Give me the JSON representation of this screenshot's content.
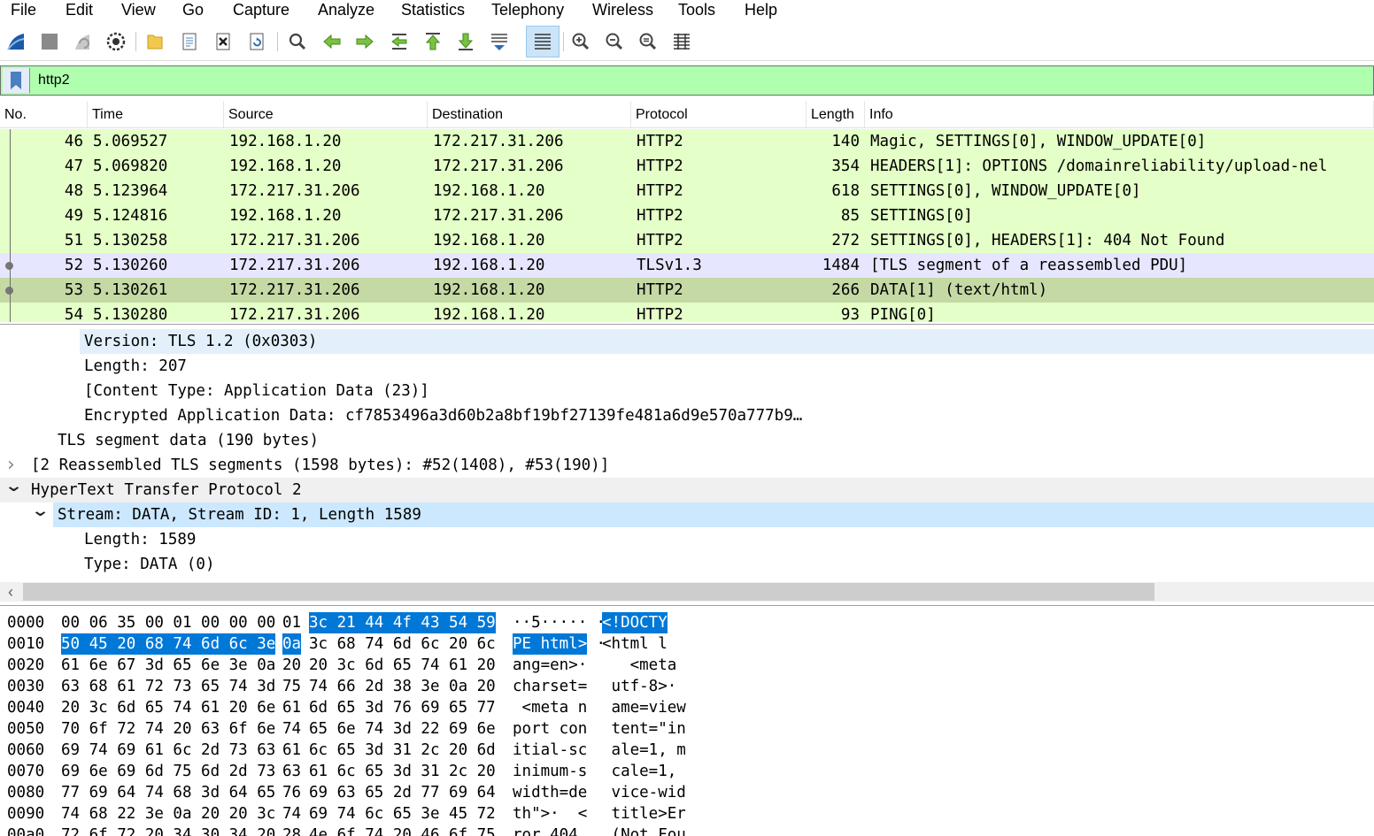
{
  "menu": [
    "File",
    "Edit",
    "View",
    "Go",
    "Capture",
    "Analyze",
    "Statistics",
    "Telephony",
    "Wireless",
    "Tools",
    "Help"
  ],
  "toolbar_icons": [
    "start-capture-icon",
    "stop-capture-icon",
    "restart-capture-icon",
    "capture-options-icon",
    "open-file-icon",
    "save-file-icon",
    "close-file-icon",
    "reload-file-icon",
    "find-packet-icon",
    "go-back-icon",
    "go-forward-icon",
    "go-to-packet-icon",
    "go-first-packet-icon",
    "go-last-packet-icon",
    "autoscroll-icon",
    "colorize-icon",
    "zoom-in-icon",
    "zoom-out-icon",
    "normal-size-icon",
    "resize-columns-icon"
  ],
  "filter": {
    "value": "http2",
    "background": "#afffaf"
  },
  "columns": [
    "No.",
    "Time",
    "Source",
    "Destination",
    "Protocol",
    "Length",
    "Info"
  ],
  "packets": [
    {
      "no": "46",
      "time": "5.069527",
      "src": "192.168.1.20",
      "dst": "172.217.31.206",
      "proto": "HTTP2",
      "len": "140",
      "info": "Magic, SETTINGS[0], WINDOW_UPDATE[0]",
      "bg": "#e4ffc7"
    },
    {
      "no": "47",
      "time": "5.069820",
      "src": "192.168.1.20",
      "dst": "172.217.31.206",
      "proto": "HTTP2",
      "len": "354",
      "info": "HEADERS[1]: OPTIONS /domainreliability/upload-nel",
      "bg": "#e4ffc7"
    },
    {
      "no": "48",
      "time": "5.123964",
      "src": "172.217.31.206",
      "dst": "192.168.1.20",
      "proto": "HTTP2",
      "len": "618",
      "info": "SETTINGS[0], WINDOW_UPDATE[0]",
      "bg": "#e4ffc7"
    },
    {
      "no": "49",
      "time": "5.124816",
      "src": "192.168.1.20",
      "dst": "172.217.31.206",
      "proto": "HTTP2",
      "len": "85",
      "info": "SETTINGS[0]",
      "bg": "#e4ffc7"
    },
    {
      "no": "51",
      "time": "5.130258",
      "src": "172.217.31.206",
      "dst": "192.168.1.20",
      "proto": "HTTP2",
      "len": "272",
      "info": "SETTINGS[0], HEADERS[1]: 404 Not Found",
      "bg": "#e4ffc7"
    },
    {
      "no": "52",
      "time": "5.130260",
      "src": "172.217.31.206",
      "dst": "192.168.1.20",
      "proto": "TLSv1.3",
      "len": "1484",
      "info": "[TLS segment of a reassembled PDU]",
      "bg": "#e7e6ff"
    },
    {
      "no": "53",
      "time": "5.130261",
      "src": "172.217.31.206",
      "dst": "192.168.1.20",
      "proto": "HTTP2",
      "len": "266",
      "info": "DATA[1] (text/html)",
      "bg": "#c5d9a5"
    },
    {
      "no": "54",
      "time": "5.130280",
      "src": "172.217.31.206",
      "dst": "192.168.1.20",
      "proto": "HTTP2",
      "len": "93",
      "info": "PING[0]",
      "bg": "#e4ffc7"
    }
  ],
  "details": [
    {
      "text": "Version: TLS 1.2 (0x0303)",
      "indent": 95,
      "bg": "#e3f0fb",
      "arrow": ""
    },
    {
      "text": "Length: 207",
      "indent": 95,
      "bg": "#ffffff",
      "arrow": ""
    },
    {
      "text": "[Content Type: Application Data (23)]",
      "indent": 95,
      "bg": "#ffffff",
      "arrow": ""
    },
    {
      "text": "Encrypted Application Data: cf7853496a3d60b2a8bf19bf27139fe481a6d9e570a777b9…",
      "indent": 95,
      "bg": "#ffffff",
      "arrow": ""
    },
    {
      "text": "TLS segment data (190 bytes)",
      "indent": 65,
      "bg": "#ffffff",
      "arrow": ""
    },
    {
      "text": "[2 Reassembled TLS segments (1598 bytes): #52(1408), #53(190)]",
      "indent": 35,
      "bg": "#ffffff",
      "arrow": "›"
    },
    {
      "text": "HyperText Transfer Protocol 2",
      "indent": 35,
      "bg": "#f0f0f0",
      "arrow": "⌄"
    },
    {
      "text": "Stream: DATA, Stream ID: 1, Length 1589",
      "indent": 65,
      "bg": "#cce8ff",
      "arrow": "⌄"
    },
    {
      "text": "Length: 1589",
      "indent": 95,
      "bg": "#ffffff",
      "arrow": ""
    },
    {
      "text": "Type: DATA (0)",
      "indent": 95,
      "bg": "#ffffff",
      "arrow": ""
    }
  ],
  "bytes": [
    {
      "off": "0000",
      "h1": "00 06 35 00 01 00 00 00",
      "h2a": "01",
      "h2b": "3c 21 44 4f 43 54 59",
      "a1": "··5·····",
      "a2a": " ·",
      "a2b": "<!DOCTY",
      "hl": "second"
    },
    {
      "off": "0010",
      "h1": "50 45 20 68 74 6d 6c 3e",
      "h2a": "0a",
      "h2b": "3c 68 74 6d 6c 20 6c",
      "a1": "PE html>",
      "a2a": " ·",
      "a2b": "<html l",
      "hl": "first"
    },
    {
      "off": "0020",
      "h1": "61 6e 67 3d 65 6e 3e 0a",
      "h2a": "20",
      "h2b": "20 3c 6d 65 74 61 20",
      "a1": "ang=en>·",
      "a2a": "",
      "a2b": "   <meta",
      "hl": ""
    },
    {
      "off": "0030",
      "h1": "63 68 61 72 73 65 74 3d",
      "h2a": "75",
      "h2b": "74 66 2d 38 3e 0a 20",
      "a1": "charset=",
      "a2a": "",
      "a2b": " utf-8>·",
      "hl": ""
    },
    {
      "off": "0040",
      "h1": "20 3c 6d 65 74 61 20 6e",
      "h2a": "61",
      "h2b": "6d 65 3d 76 69 65 77",
      "a1": " <meta n",
      "a2a": "",
      "a2b": " ame=view",
      "hl": ""
    },
    {
      "off": "0050",
      "h1": "70 6f 72 74 20 63 6f 6e",
      "h2a": "74",
      "h2b": "65 6e 74 3d 22 69 6e",
      "a1": "port con",
      "a2a": "",
      "a2b": " tent=\"in",
      "hl": ""
    },
    {
      "off": "0060",
      "h1": "69 74 69 61 6c 2d 73 63",
      "h2a": "61",
      "h2b": "6c 65 3d 31 2c 20 6d",
      "a1": "itial-sc",
      "a2a": "",
      "a2b": " ale=1, m",
      "hl": ""
    },
    {
      "off": "0070",
      "h1": "69 6e 69 6d 75 6d 2d 73",
      "h2a": "63",
      "h2b": "61 6c 65 3d 31 2c 20",
      "a1": "inimum-s",
      "a2a": "",
      "a2b": " cale=1,",
      "hl": ""
    },
    {
      "off": "0080",
      "h1": "77 69 64 74 68 3d 64 65",
      "h2a": "76",
      "h2b": "69 63 65 2d 77 69 64",
      "a1": "width=de",
      "a2a": "",
      "a2b": " vice-wid",
      "hl": ""
    },
    {
      "off": "0090",
      "h1": "74 68 22 3e 0a 20 20 3c",
      "h2a": "74",
      "h2b": "69 74 6c 65 3e 45 72",
      "a1": "th\">·  <",
      "a2a": "",
      "a2b": " title>Er",
      "hl": ""
    },
    {
      "off": "00a0",
      "h1": "72 6f 72 20 34 30 34 20",
      "h2a": "28",
      "h2b": "4e 6f 74 20 46 6f 75",
      "a1": "ror 404 ",
      "a2a": "",
      "a2b": " (Not Fou",
      "hl": ""
    }
  ]
}
